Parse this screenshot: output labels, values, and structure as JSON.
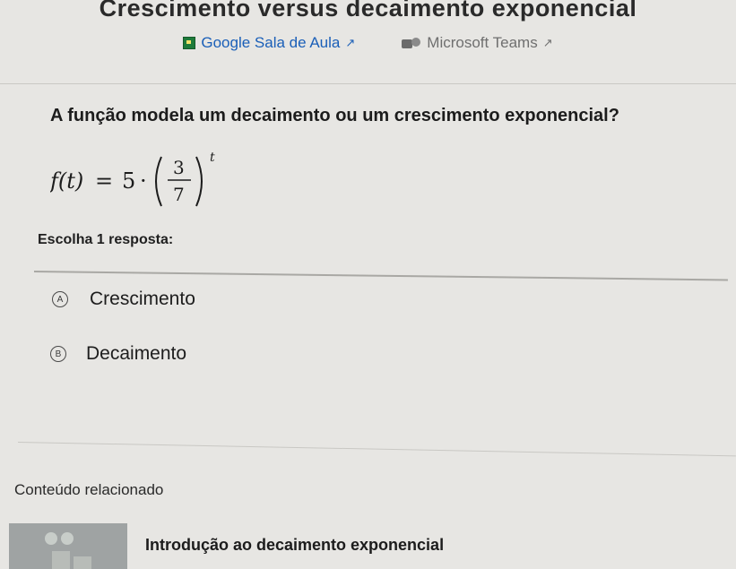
{
  "page": {
    "title": "Crescimento versus decaimento exponencial"
  },
  "share": {
    "google_label": "Google Sala de Aula",
    "teams_label": "Microsoft Teams",
    "google_icon": "google-classroom-icon",
    "teams_icon": "microsoft-teams-icon",
    "external_icon": "external-link-icon"
  },
  "question": {
    "text": "A função modela um decaimento ou um crescimento exponencial?",
    "formula": {
      "lhs": "f(t)",
      "equals": "=",
      "coefficient": "5",
      "dot": "·",
      "numerator": "3",
      "denominator": "7",
      "exponent": "t"
    }
  },
  "answer": {
    "prompt": "Escolha 1 resposta:",
    "options": [
      {
        "letter": "A",
        "label": "Crescimento"
      },
      {
        "letter": "B",
        "label": "Decaimento"
      }
    ]
  },
  "related": {
    "title": "Conteúdo relacionado",
    "items": [
      {
        "label": "Introdução ao decaimento exponencial"
      }
    ]
  },
  "colors": {
    "link": "#1a5fb8",
    "background": "#e7e6e3"
  }
}
